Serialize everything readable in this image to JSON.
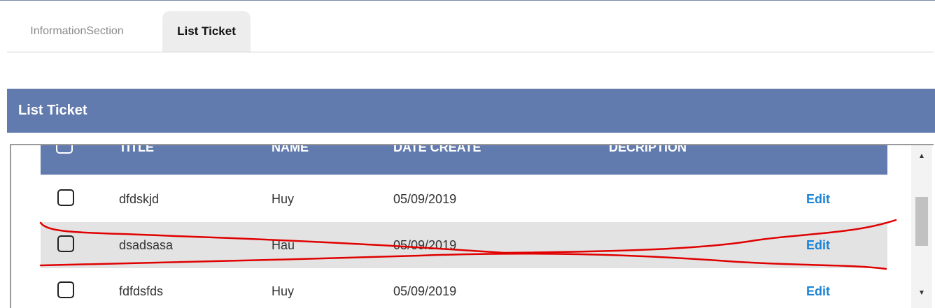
{
  "tabs": [
    {
      "label": "InformationSection",
      "active": false
    },
    {
      "label": "List Ticket",
      "active": true
    }
  ],
  "panel": {
    "title": "List Ticket"
  },
  "table": {
    "columns": [
      "TITLE",
      "NAME",
      "DATE CREATE",
      "DECRIPTION"
    ],
    "rows": [
      {
        "title": "dfdskjd",
        "name": "Huy",
        "date": "05/09/2019",
        "description": "",
        "action": "Edit"
      },
      {
        "title": "dsadsasa",
        "name": "Hau",
        "date": "05/09/2019",
        "description": "",
        "action": "Edit"
      },
      {
        "title": "fdfdsfds",
        "name": "Huy",
        "date": "05/09/2019",
        "description": "",
        "action": "Edit"
      }
    ]
  },
  "scrollbar": {
    "up_icon": "▲",
    "down_icon": "▼"
  },
  "colors": {
    "header": "#627bae",
    "link": "#1a84d8",
    "annotation": "#e00000",
    "row_alt": "#e3e3e3"
  }
}
